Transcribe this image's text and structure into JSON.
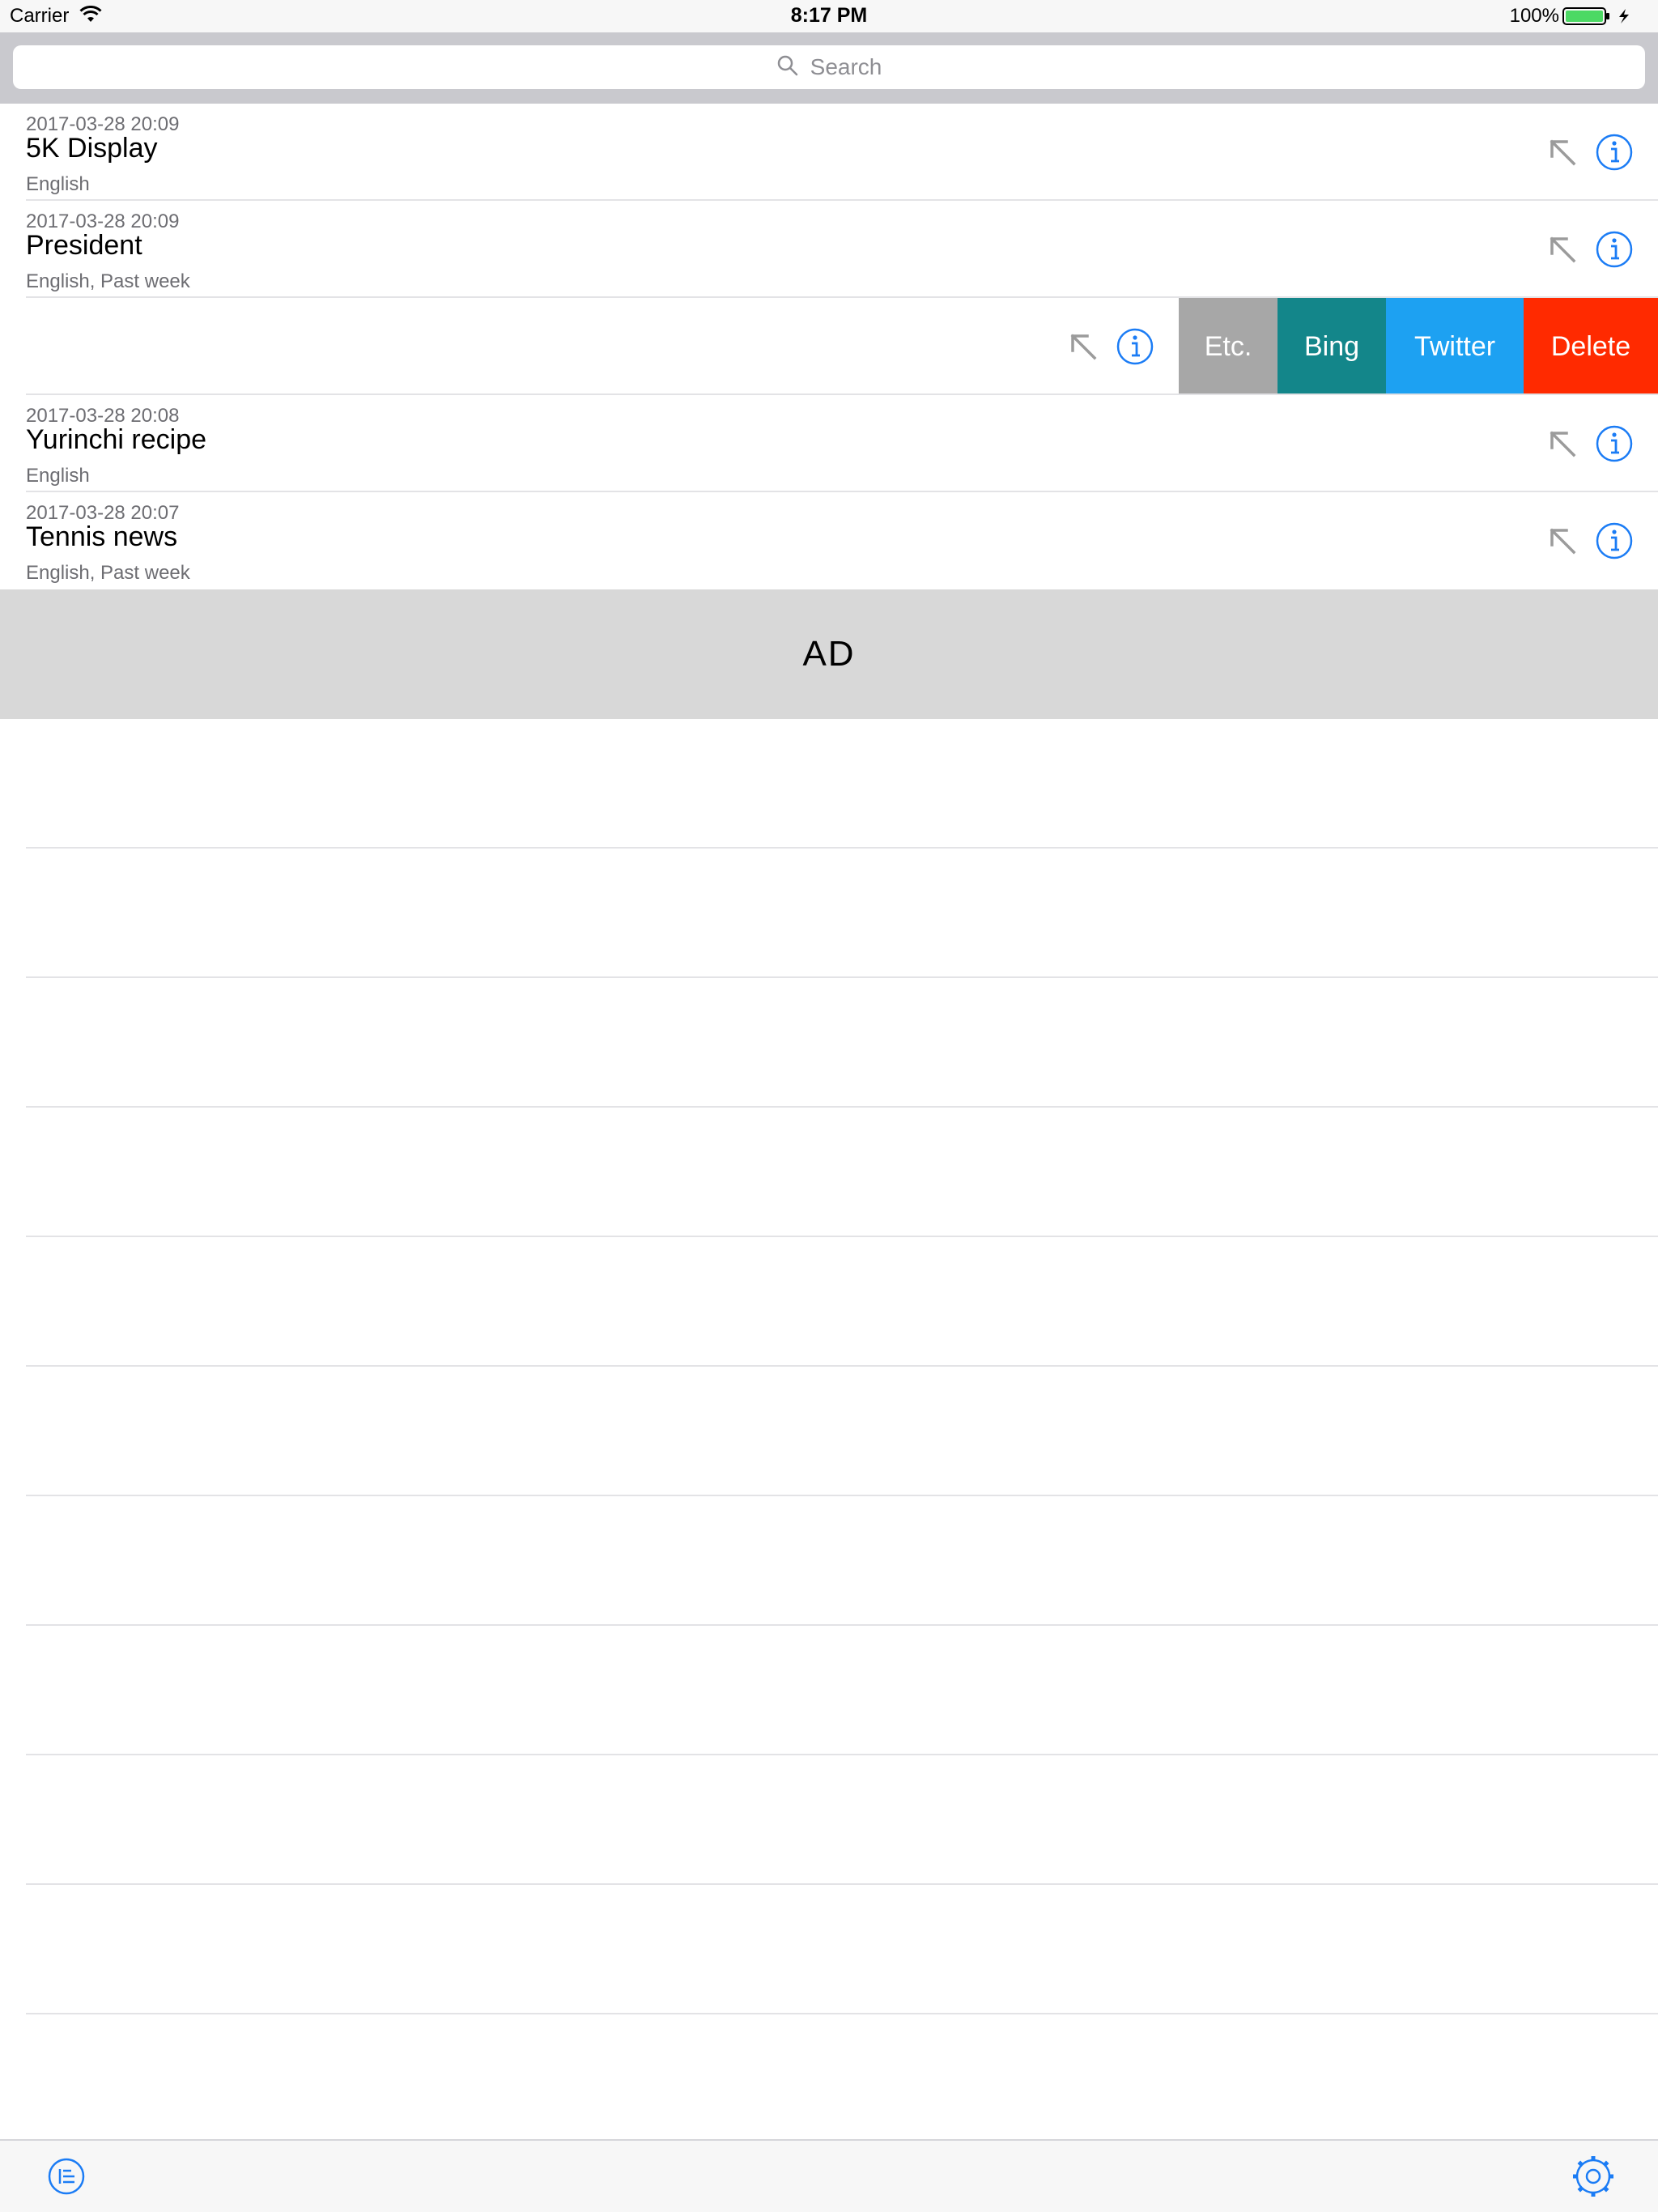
{
  "status_bar": {
    "carrier": "Carrier",
    "time": "8:17 PM",
    "battery": "100%",
    "icons": [
      "wifi-icon",
      "battery-icon",
      "charging-bolt-icon"
    ]
  },
  "search": {
    "placeholder": "Search",
    "icon": "search-icon"
  },
  "history": [
    {
      "date": "2017-03-28 20:09",
      "title": "5K Display",
      "sub": "English"
    },
    {
      "date": "2017-03-28 20:09",
      "title": "President",
      "sub": "English, Past week"
    },
    {
      "date": "",
      "title": "",
      "sub": "",
      "swiped": true
    },
    {
      "date": "2017-03-28 20:08",
      "title": "Yurinchi recipe",
      "sub": "English"
    },
    {
      "date": "2017-03-28 20:07",
      "title": "Tennis news",
      "sub": "English, Past week"
    }
  ],
  "row_icons": [
    "arrow-up-left-icon",
    "info-icon"
  ],
  "swipe_actions": [
    {
      "label": "Etc.",
      "color": "#a7a7a7"
    },
    {
      "label": "Bing",
      "color": "#13868a"
    },
    {
      "label": "Twitter",
      "color": "#1da1f2"
    },
    {
      "label": "Delete",
      "color": "#ff2a00"
    }
  ],
  "ad": {
    "label": "AD"
  },
  "toolbar": {
    "left_icon": "history-list-icon",
    "right_icon": "settings-gear-icon"
  },
  "colors": {
    "accent": "#1b7cf5",
    "arrow_gray": "#9b9b9b",
    "separator": "#e3e3e6"
  }
}
